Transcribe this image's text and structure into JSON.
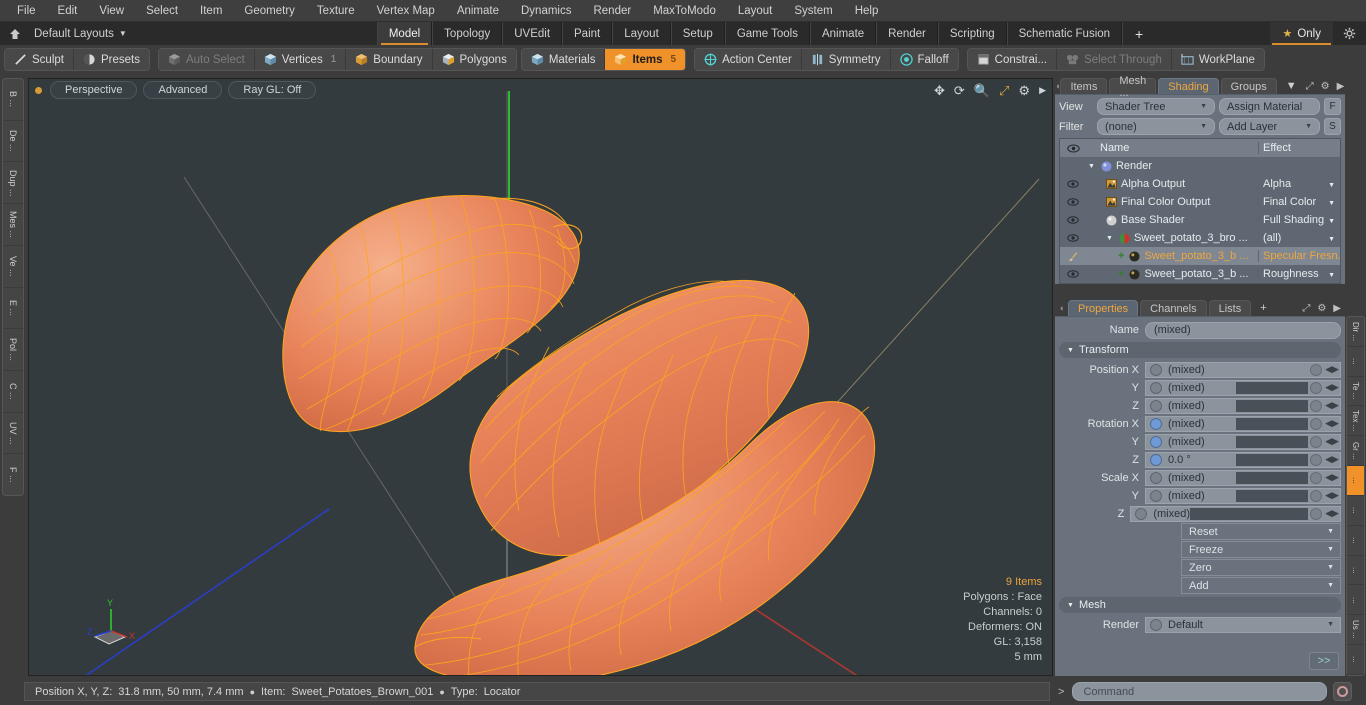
{
  "menubar": {
    "items": [
      "File",
      "Edit",
      "View",
      "Select",
      "Item",
      "Geometry",
      "Texture",
      "Vertex Map",
      "Animate",
      "Dynamics",
      "Render",
      "MaxToModo",
      "Layout",
      "System",
      "Help"
    ]
  },
  "layoutbar": {
    "home_icon": "home-icon",
    "layouts_label": "Default Layouts",
    "tabs": [
      "Model",
      "Topology",
      "UVEdit",
      "Paint",
      "Layout",
      "Setup",
      "Game Tools",
      "Animate",
      "Render",
      "Scripting",
      "Schematic Fusion"
    ],
    "active_tab": "Model",
    "plus_label": "+",
    "only_label": "Only",
    "gear_icon": "gear-icon",
    "accent": "#d98e2b"
  },
  "modebar": {
    "left_group": [
      {
        "label": "Sculpt",
        "icon": "pen-icon",
        "state": "normal"
      },
      {
        "label": "Presets",
        "icon": "preset-sphere-icon",
        "state": "normal"
      }
    ],
    "select_group": [
      {
        "label": "Auto Select",
        "icon": "cube-grey-icon",
        "state": "dim",
        "count": ""
      },
      {
        "label": "Vertices",
        "icon": "cube-vertices-icon",
        "state": "normal",
        "count": "1"
      },
      {
        "label": "Boundary",
        "icon": "cube-boundary-icon",
        "state": "normal",
        "count": ""
      },
      {
        "label": "Polygons",
        "icon": "cube-polygons-icon",
        "state": "normal",
        "count": ""
      }
    ],
    "items_group": [
      {
        "label": "Materials",
        "icon": "cube-materials-icon",
        "state": "normal",
        "count": ""
      },
      {
        "label": "Items",
        "icon": "cube-items-icon",
        "state": "active",
        "count": "5"
      }
    ],
    "action_group": [
      {
        "label": "Action Center",
        "icon": "crosshair-icon",
        "state": "normal"
      },
      {
        "label": "Symmetry",
        "icon": "symmetry-icon",
        "state": "normal"
      },
      {
        "label": "Falloff",
        "icon": "falloff-icon",
        "state": "normal"
      }
    ],
    "constraint_group": [
      {
        "label": "Constrai...",
        "icon": "constraint-icon",
        "state": "normal"
      },
      {
        "label": "Select Through",
        "icon": "select-through-icon",
        "state": "dim"
      },
      {
        "label": "WorkPlane",
        "icon": "workplane-icon",
        "state": "normal"
      }
    ]
  },
  "left_rail": {
    "items": [
      "B ...",
      "De ...",
      "Dup ...",
      "Mes ...",
      "Ve ...",
      "E ...",
      "Pol ...",
      "C ...",
      "UV ...",
      "F ..."
    ]
  },
  "viewport": {
    "dot_color": "#d79b35",
    "pills": [
      "Perspective",
      "Advanced",
      "Ray GL: Off"
    ],
    "tool_icons": [
      "move-icon",
      "rotate-icon",
      "zoom-icon",
      "maximize-icon",
      "gear-icon",
      "play-icon"
    ],
    "stats": {
      "items": "9 Items",
      "polygons": "Polygons : Face",
      "channels": "Channels: 0",
      "deformers": "Deformers: ON",
      "gl": "GL: 3,158",
      "scale": "5 mm"
    },
    "gizmo": {
      "x": "X",
      "y": "Y",
      "z": "Z"
    },
    "mesh_color": "#e88b5c",
    "wire_color": "#ffa41f"
  },
  "shading_panel": {
    "tabs": [
      "Items",
      "Mesh ...",
      "Shading",
      "Groups"
    ],
    "active_tab": "Shading",
    "caret_icon": "chevron-down-icon",
    "expand_icon": "expand-icon",
    "gear_icon": "gear-icon",
    "arrow_icon": "chevron-right-icon",
    "view_label": "View",
    "view_value": "Shader Tree",
    "assign_material": "Assign Material",
    "f_button": "F",
    "filter_label": "Filter",
    "filter_value": "(none)",
    "add_layer": "Add Layer",
    "s_button": "S",
    "columns": {
      "name": "Name",
      "effect": "Effect"
    },
    "rows": [
      {
        "name": "Render",
        "effect": "",
        "indent": 0,
        "icon": "render-sphere-icon",
        "eye": false,
        "selected": false,
        "expander": true
      },
      {
        "name": "Alpha Output",
        "effect": "Alpha",
        "indent": 1,
        "icon": "image-output-icon",
        "eye": true,
        "selected": false
      },
      {
        "name": "Final Color Output",
        "effect": "Final Color",
        "indent": 1,
        "icon": "image-output-icon",
        "eye": true,
        "selected": false
      },
      {
        "name": "Base Shader",
        "effect": "Full Shading",
        "indent": 1,
        "icon": "grey-sphere-icon",
        "eye": true,
        "selected": false
      },
      {
        "name": "Sweet_potato_3_bro ...",
        "effect": "(all)",
        "indent": 1,
        "icon": "material-sphere-icon",
        "eye": true,
        "selected": false,
        "expander": true
      },
      {
        "name": "Sweet_potato_3_b ...",
        "effect": "Specular Fresn...",
        "indent": 2,
        "icon": "texture-sphere-icon",
        "eye": false,
        "selected": true,
        "plus": true
      },
      {
        "name": "Sweet_potato_3_b ...",
        "effect": "Roughness",
        "indent": 2,
        "icon": "texture-sphere-icon",
        "eye": true,
        "selected": false,
        "plus": true
      }
    ]
  },
  "properties_panel": {
    "tabs": [
      "Properties",
      "Channels",
      "Lists"
    ],
    "active_tab": "Properties",
    "plus_label": "+",
    "name_label": "Name",
    "name_value": "(mixed)",
    "transform_section": "Transform",
    "transform_rows": [
      {
        "label": "Position X",
        "value": "(mixed)",
        "radio": false,
        "bar": "none"
      },
      {
        "label": "Y",
        "value": "(mixed)",
        "radio": false,
        "bar": "normal"
      },
      {
        "label": "Z",
        "value": "(mixed)",
        "radio": false,
        "bar": "normal"
      },
      {
        "label": "Rotation X",
        "value": "(mixed)",
        "radio": true,
        "bar": "normal"
      },
      {
        "label": "Y",
        "value": "(mixed)",
        "radio": true,
        "bar": "normal"
      },
      {
        "label": "Z",
        "value": "0.0 °",
        "radio": true,
        "bar": "normal"
      },
      {
        "label": "Scale X",
        "value": "(mixed)",
        "radio": false,
        "bar": "normal"
      },
      {
        "label": "Y",
        "value": "(mixed)",
        "radio": false,
        "bar": "normal"
      },
      {
        "label": "Z",
        "value": "(mixed)",
        "radio": false,
        "bar": "wide"
      }
    ],
    "actions": [
      "Reset",
      "Freeze",
      "Zero",
      "Add"
    ],
    "mesh_section": "Mesh",
    "render_label": "Render",
    "render_value": "Default",
    "more_button": ">>"
  },
  "right_rail": {
    "items": [
      "Dir ...",
      "...",
      "Te ...",
      "Tex ...",
      "Gr ...",
      "...",
      "...",
      "...",
      "...",
      "...",
      "Us ...",
      "..."
    ],
    "active_index": 5
  },
  "statusbar": {
    "position_label": "Position X, Y, Z:",
    "position_value": "31.8 mm, 50 mm, 7.4 mm",
    "item_label": "Item:",
    "item_value": "Sweet_Potatoes_Brown_001",
    "type_label": "Type:",
    "type_value": "Locator",
    "prompt": ">",
    "command_placeholder": "Command",
    "record_icon": "record-icon"
  }
}
